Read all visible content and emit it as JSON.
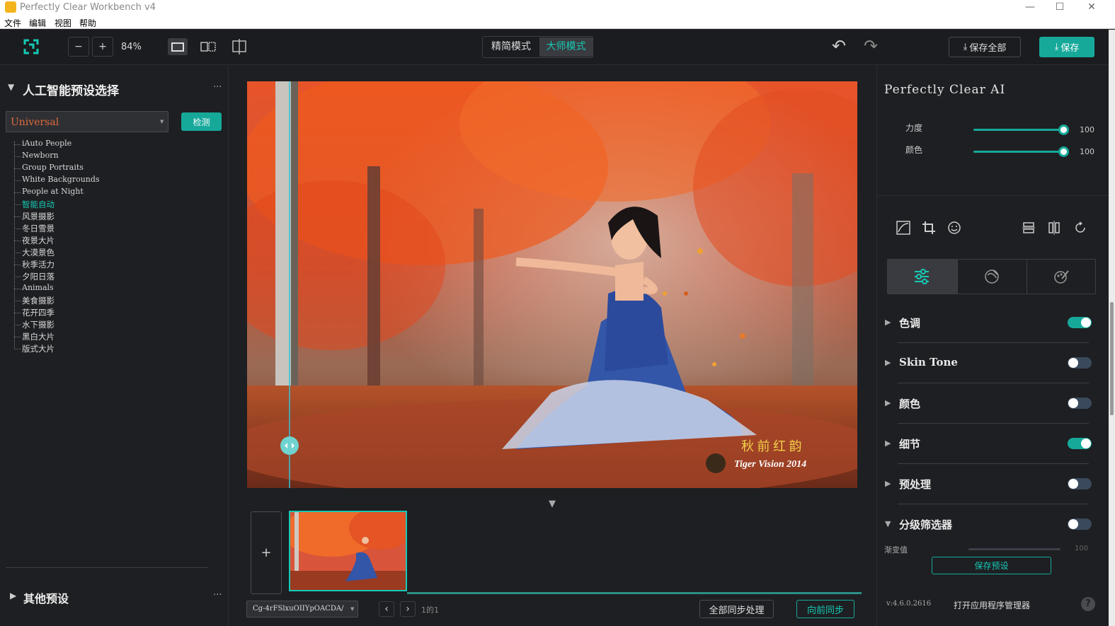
{
  "window": {
    "title": "Perfectly Clear Workbench v4",
    "minimize": "—",
    "maximize": "☐",
    "close": "✕"
  },
  "menu": [
    "文件",
    "编辑",
    "视图",
    "帮助"
  ],
  "toolbar": {
    "zoom_out": "−",
    "zoom_in": "+",
    "zoom_level": "84%",
    "mode_simple": "精简模式",
    "mode_master": "大师模式",
    "undo": "↶",
    "redo": "↷",
    "save_all": "保存全部",
    "save": "保存"
  },
  "left": {
    "preset_title": "人工智能预设选择",
    "more": "···",
    "preset_value": "Universal",
    "detect_button": "检测",
    "presets": [
      "iAuto People",
      "Newborn",
      "Group Portraits",
      "White Backgrounds",
      "People at Night",
      "智能自动",
      "风景摄影",
      "冬日雪景",
      "夜景大片",
      "大漠景色",
      "秋季活力",
      "夕阳日落",
      "Animals",
      "美食摄影",
      "花开四季",
      "水下摄影",
      "黑白大片",
      "版式大片"
    ],
    "selected_preset": "智能自动",
    "other_title": "其他预设",
    "other_more": "···"
  },
  "center": {
    "photo_watermark_cn": "秋 前 红 韵",
    "photo_watermark_en": "Tiger Vision 2014",
    "collapse": "▼",
    "add": "+",
    "filename": "Cg-4rFSlxuOIIYpOACDA/",
    "prev": "‹",
    "next": "›",
    "page": "1的1",
    "sync_all": "全部同步处理",
    "sync_forward": "向前同步"
  },
  "right": {
    "title": "Perfectly Clear AI",
    "sliders": [
      {
        "label": "力度",
        "value": "100",
        "level": 1.0
      },
      {
        "label": "颜色",
        "value": "100",
        "level": 1.0
      }
    ],
    "sections": [
      {
        "label": "色调",
        "on": true
      },
      {
        "label": "Skin Tone",
        "on": false
      },
      {
        "label": "颜色",
        "on": false
      },
      {
        "label": "细节",
        "on": true
      },
      {
        "label": "预处理",
        "on": false
      },
      {
        "label": "分级筛选器",
        "on": false
      }
    ],
    "gradient_label": "渐变值",
    "gradient_value": "100",
    "save_preset": "保存预设",
    "version": "v:4.6.0.2616",
    "open_manager": "打开应用程序管理器",
    "help": "?"
  },
  "colors": {
    "accent": "#16a99a",
    "bg": "#1e1f22",
    "toggle_off": "#3a4a5c"
  }
}
